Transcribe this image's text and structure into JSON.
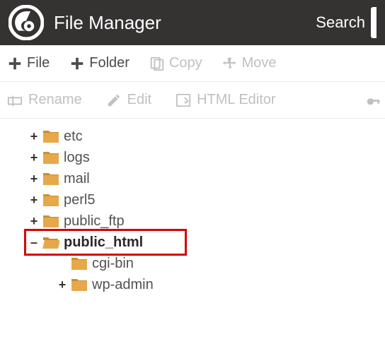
{
  "header": {
    "title": "File Manager",
    "search": "Search"
  },
  "toolbar1": {
    "file": "File",
    "folder": "Folder",
    "copy": "Copy",
    "move": "Move"
  },
  "toolbar2": {
    "rename": "Rename",
    "edit": "Edit",
    "htmleditor": "HTML Editor"
  },
  "tree": {
    "items": [
      {
        "label": "etc",
        "expander": "+",
        "open": false,
        "indent": 1
      },
      {
        "label": "logs",
        "expander": "+",
        "open": false,
        "indent": 1
      },
      {
        "label": "mail",
        "expander": "+",
        "open": false,
        "indent": 1
      },
      {
        "label": "perl5",
        "expander": "+",
        "open": false,
        "indent": 1
      },
      {
        "label": "public_ftp",
        "expander": "+",
        "open": false,
        "indent": 1
      },
      {
        "label": "public_html",
        "expander": "–",
        "open": true,
        "indent": 1,
        "highlighted": true,
        "bold": true
      },
      {
        "label": "cgi-bin",
        "expander": "",
        "open": false,
        "indent": 2
      },
      {
        "label": "wp-admin",
        "expander": "+",
        "open": false,
        "indent": 2
      }
    ]
  }
}
